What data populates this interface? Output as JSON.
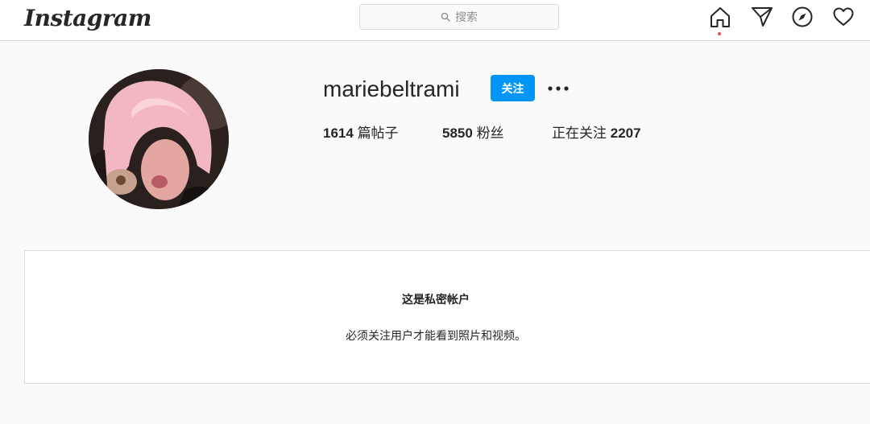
{
  "header": {
    "logo_text": "Instagram",
    "search_placeholder": "搜索",
    "icons": [
      "home-icon",
      "direct-message-icon",
      "explore-compass-icon",
      "activity-heart-icon"
    ],
    "accent_color": "#0095f6",
    "notification_dot_color": "#ed4956"
  },
  "profile": {
    "username": "mariebeltrami",
    "follow_label": "关注",
    "more_icon": "more-options-icon",
    "stats": {
      "posts_count": "1614",
      "posts_label": "篇帖子",
      "followers_count": "5850",
      "followers_label": "粉丝",
      "following_label": "正在关注",
      "following_count": "2207"
    }
  },
  "private_notice": {
    "title": "这是私密帐户",
    "subtitle": "必须关注用户才能看到照片和视频。"
  }
}
